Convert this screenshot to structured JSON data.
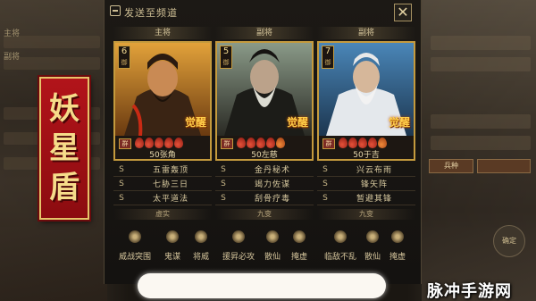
{
  "dialog": {
    "send_label": "发送至频道",
    "close_label": "✕"
  },
  "banner": {
    "chars": [
      "妖",
      "星",
      "盾"
    ]
  },
  "columns": [
    {
      "role": "主将",
      "level": "6",
      "level_sub": "御",
      "faction": "群",
      "name": "50张角",
      "awaken": "觉醒",
      "skills": [
        "五雷轰顶",
        "七胁三日",
        "太平道法"
      ],
      "subtitle": "虚实"
    },
    {
      "role": "副将",
      "level": "5",
      "level_sub": "御",
      "faction": "群",
      "name": "50左慈",
      "awaken": "觉醒",
      "skills": [
        "金丹秘术",
        "竭力佐谋",
        "刮骨疗毒"
      ],
      "subtitle": "九变"
    },
    {
      "role": "副将",
      "level": "7",
      "level_sub": "御",
      "faction": "群",
      "name": "50于吉",
      "awaken": "觉醒",
      "skills": [
        "兴云布雨",
        "锋矢阵",
        "暂避其锋"
      ],
      "subtitle": "九变"
    }
  ],
  "skill_prefix": "S",
  "items": [
    {
      "label": "威战突围",
      "icon": "war-icon"
    },
    {
      "label": "鬼谋",
      "icon": "strategy-icon"
    },
    {
      "label": "将威",
      "icon": "general-icon"
    },
    {
      "label": "援昇必攻",
      "icon": "attack-icon"
    },
    {
      "label": "散仙",
      "icon": "immortal-icon"
    },
    {
      "label": "掩虚",
      "icon": "veil-icon"
    },
    {
      "label": "临敌不乱",
      "icon": "calm-icon"
    },
    {
      "label": "散仙",
      "icon": "immortal-icon"
    },
    {
      "label": "掩虚",
      "icon": "veil-icon"
    }
  ],
  "background": {
    "left_labels": [
      "主将",
      "副将"
    ],
    "right_tab": "兵种",
    "right_circle": "确定"
  },
  "watermark": "脉冲手游网",
  "colors": {
    "accent_gold": "#c49a3d",
    "banner_red": "#b2141a",
    "awaken_gold": "#ffcf4a"
  }
}
